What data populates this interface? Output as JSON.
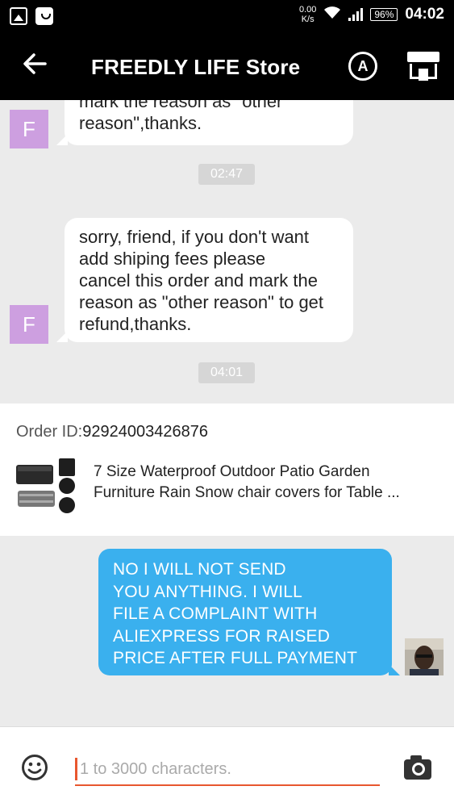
{
  "status_bar": {
    "speed_value": "0.00",
    "speed_unit": "K/s",
    "battery": "96%",
    "time": "04:02"
  },
  "header": {
    "back_icon": "arrow-left-icon",
    "title": "FREEDLY LIFE Store",
    "translate_label": "A",
    "store_icon": "shop-icon"
  },
  "messages": [
    {
      "sender": "store",
      "avatar_letter": "F",
      "lines": [
        "mark the reason as \"other",
        "reason\",thanks."
      ]
    },
    {
      "type": "timestamp",
      "text": "02:47"
    },
    {
      "sender": "store",
      "avatar_letter": "F",
      "lines": [
        "sorry, friend, if you don't want",
        "add shiping fees please",
        "cancel this order and mark the",
        "reason as \"other reason\" to get",
        "refund,thanks."
      ]
    },
    {
      "type": "timestamp",
      "text": "04:01"
    }
  ],
  "order": {
    "label": "Order ID:",
    "id": "92924003426876",
    "title": "7 Size Waterproof Outdoor Patio Garden Furniture Rain Snow chair covers for Table ...",
    "title_line1": "7 Size Waterproof Outdoor Patio Garden",
    "title_line2": "Furniture Rain Snow chair covers for Table ..."
  },
  "my_message": {
    "lines": [
      "NO I WILL NOT SEND",
      "YOU ANYTHING.  I WILL",
      "FILE A COMPLAINT WITH",
      "ALIEXPRESS FOR RAISED",
      "PRICE AFTER FULL PAYMENT"
    ]
  },
  "input": {
    "placeholder": "1 to 3000 characters.",
    "value": ""
  },
  "colors": {
    "accent": "#e8572f",
    "my_bubble": "#3ab0ee",
    "store_avatar": "#cd9fe0",
    "chat_background": "#ebebeb"
  }
}
